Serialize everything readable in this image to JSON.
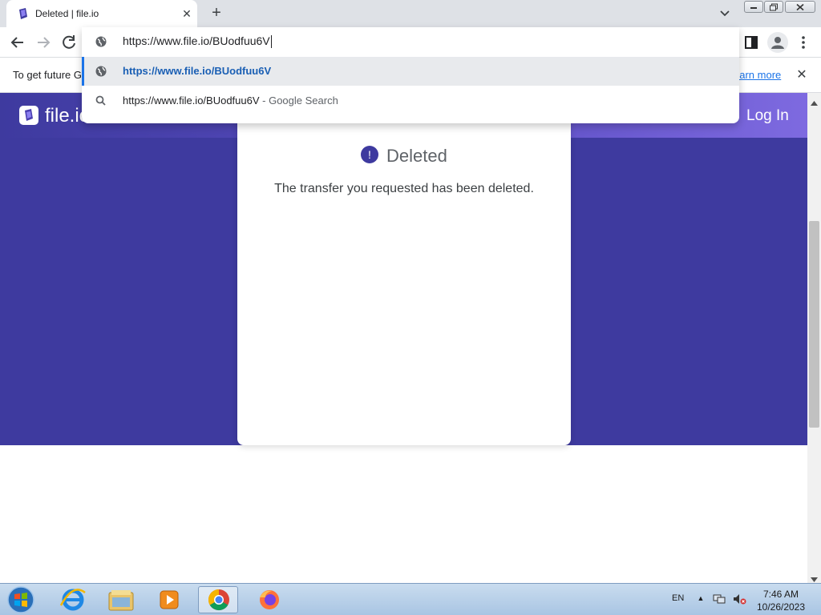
{
  "browser": {
    "tab": {
      "title": "Deleted | file.io",
      "close_icon": "close-icon"
    },
    "new_tab_icon": "plus-icon",
    "tab_search_icon": "chevron-down-icon",
    "window_controls": [
      "minimize-icon",
      "maximize-icon",
      "close-icon"
    ]
  },
  "toolbar": {
    "back_icon": "arrow-left-icon",
    "forward_icon": "arrow-right-icon",
    "reload_icon": "reload-icon",
    "side_panel_icon": "side-panel-icon",
    "profile_icon": "person-icon",
    "menu_icon": "kebab-menu-icon"
  },
  "omnibox": {
    "input_value": "https://www.file.io/BUodfuu6V",
    "suggestions": [
      {
        "icon": "globe-icon",
        "text": "https://www.file.io/BUodfuu6V",
        "selected": true
      },
      {
        "icon": "search-icon",
        "text": "https://www.file.io/BUodfuu6V",
        "detail": " - Google Search"
      }
    ]
  },
  "infobar": {
    "text": "To get future G",
    "link": "earn more",
    "close_icon": "close-icon"
  },
  "site": {
    "logo_text": "file.io",
    "login_label": "Log In",
    "card": {
      "heading": "Deleted",
      "message": "The transfer you requested has been deleted."
    }
  },
  "taskbar": {
    "apps": [
      "start-orb-icon",
      "internet-explorer-icon",
      "file-explorer-icon",
      "media-player-icon",
      "chrome-icon",
      "firefox-icon"
    ],
    "language": "EN",
    "time": "7:46 AM",
    "date": "10/26/2023"
  },
  "colors": {
    "brand_purple": "#3e3a9f",
    "accent_blue": "#1a73e8",
    "tab_strip": "#dee1e6"
  }
}
